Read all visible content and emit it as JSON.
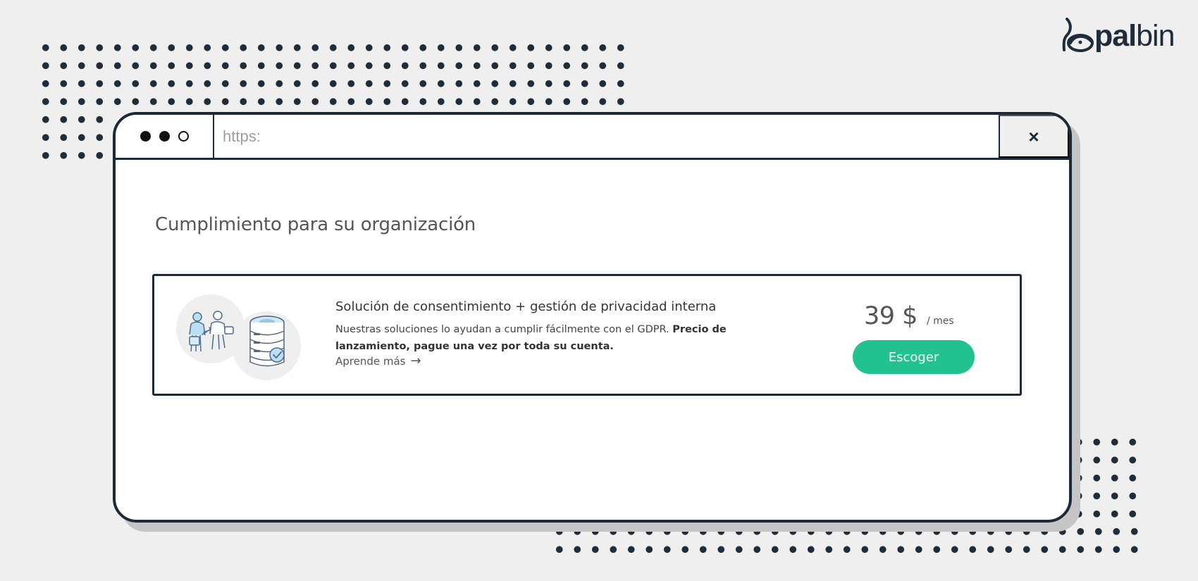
{
  "brand": {
    "logo_name": "palbin-logo",
    "bold_text": "pal",
    "light_text": "bin"
  },
  "browser": {
    "address": "https:",
    "close_symbol": "×",
    "window_controls": [
      "filled-circle",
      "filled-circle",
      "outlined-circle"
    ]
  },
  "page": {
    "title": "Cumplimiento para su organización"
  },
  "plan": {
    "title": "Solución de consentimiento + gestión de privacidad interna",
    "description": "Nuestras soluciones lo ayudan a cumplir fácilmente con el GDPR.",
    "highlight": "Precio de lanzamiento, pague una vez por toda su cuenta.",
    "learn_more": "Aprende más",
    "arrow": "→",
    "price_amount": "39 $",
    "price_period": "/ mes",
    "button_label": "Escoger"
  },
  "icons": [
    "palbin-logo-icon",
    "window-dot-icon",
    "close-icon",
    "privacy-people-icon",
    "database-check-icon",
    "arrow-right-icon"
  ],
  "colors": {
    "background": "#efefef",
    "dark_navy": "#1b2a36",
    "accent_green": "#21c28f",
    "text_gray": "#555555"
  }
}
